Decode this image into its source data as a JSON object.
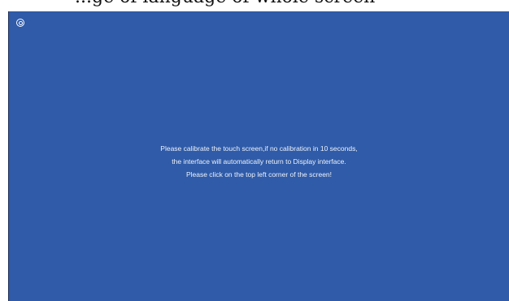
{
  "header_caption": "...ge of language of whole screen",
  "screen": {
    "corner_icon": "target-crosshair-icon",
    "background_color": "#2f5ba8",
    "message_lines": [
      "Please calibrate the touch screen,if no calibration in 10 seconds,",
      "the interface will automatically return to Display interface.",
      "Please click on the top left corner of the screen!"
    ]
  }
}
